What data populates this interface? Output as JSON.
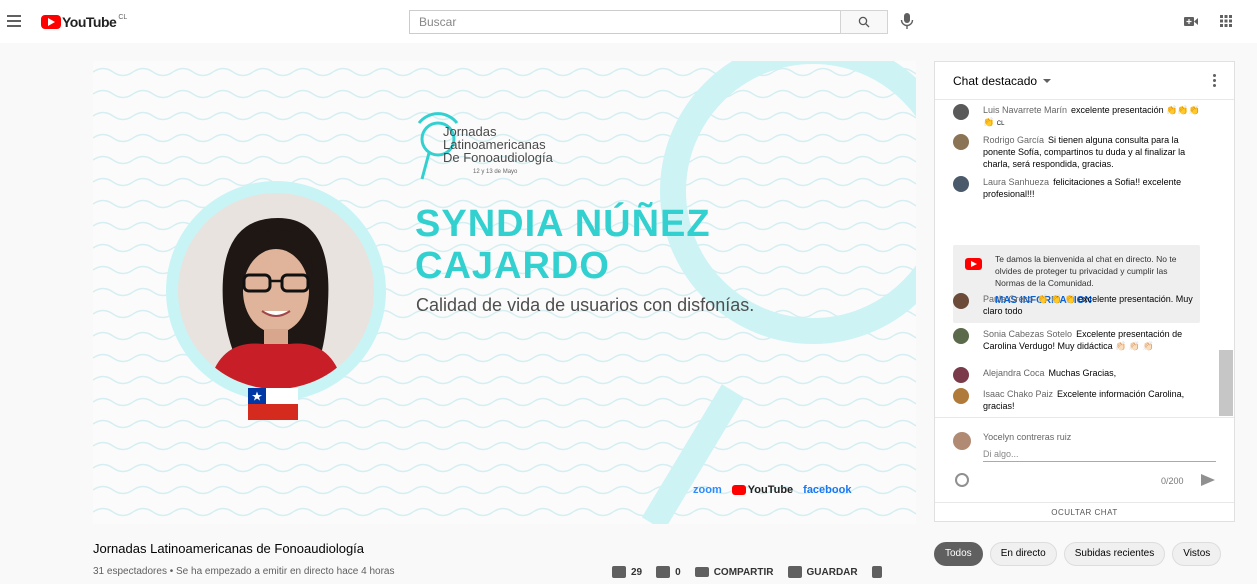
{
  "header": {
    "logo_text": "YouTube",
    "country_code": "CL",
    "search_placeholder": "Buscar",
    "icons": [
      "menu-icon",
      "search-icon",
      "mic-icon",
      "create-video-icon",
      "apps-icon"
    ]
  },
  "video": {
    "event_title_lines": [
      "Jornadas",
      "Latinoamericanas",
      "De Fonoaudiología"
    ],
    "event_date": "12 y 13 de Mayo",
    "speaker_lines": [
      "SYNDIA NÚÑEZ",
      "CAJARDO"
    ],
    "talk_title": "Calidad de vida de usuarios con disfonías.",
    "brands": {
      "zoom": "zoom",
      "youtube": "YouTube",
      "facebook": "facebook"
    },
    "accent_color": "#33d0d0"
  },
  "chat": {
    "header": "Chat destacado",
    "messages": [
      {
        "author": "Luis Navarrete Marín",
        "text": "excelente presentación 👏👏👏👏",
        "badge": "CL",
        "avatar_color": "#5a5a5a"
      },
      {
        "author": "Rodrigo García",
        "text": "Si tienen alguna consulta para la ponente Sofía, compartinos tu duda y al finalizar la charla, será respondida, gracias.",
        "avatar_color": "#8b7355"
      },
      {
        "author": "Laura Sanhueza",
        "text": "felicitaciones a Sofia!! excelente profesional!!!",
        "avatar_color": "#4a5a6a"
      },
      {
        "author": "Paula Greco",
        "text": "👏 👏 👏 excelente presentación. Muy claro todo",
        "avatar_color": "#6b4a3a"
      },
      {
        "author": "Sonia Cabezas Sotelo",
        "text": "Excelente presentación de Carolina Verdugo! Muy didáctica 👏🏻 👏🏻 👏🏻",
        "avatar_color": "#5a6a4a"
      },
      {
        "author": "Alejandra Coca",
        "text": "Muchas Gracias,",
        "avatar_color": "#7a3a4a"
      },
      {
        "author": "Isaac Chako Paiz",
        "text": "Excelente información Carolina, gracias!",
        "avatar_color": "#b07a3a"
      }
    ],
    "welcome_text": "Te damos la bienvenida al chat en directo. No te olvides de proteger tu privacidad y cumplir las Normas de la Comunidad.",
    "welcome_link": "MAS INFORMACION",
    "current_user": "Yocelyn contreras ruiz",
    "input_placeholder": "Di algo...",
    "char_count": "0/200",
    "hide_label": "OCULTAR CHAT"
  },
  "below": {
    "title": "Jornadas Latinoamericanas de Fonoaudiología",
    "meta": "31 espectadores • Se ha empezado a emitir en directo hace 4 horas",
    "likes": "29",
    "dislikes": "0",
    "share": "COMPARTIR",
    "save": "GUARDAR"
  },
  "chips": [
    "Todos",
    "En directo",
    "Subidas recientes",
    "Vistos"
  ]
}
